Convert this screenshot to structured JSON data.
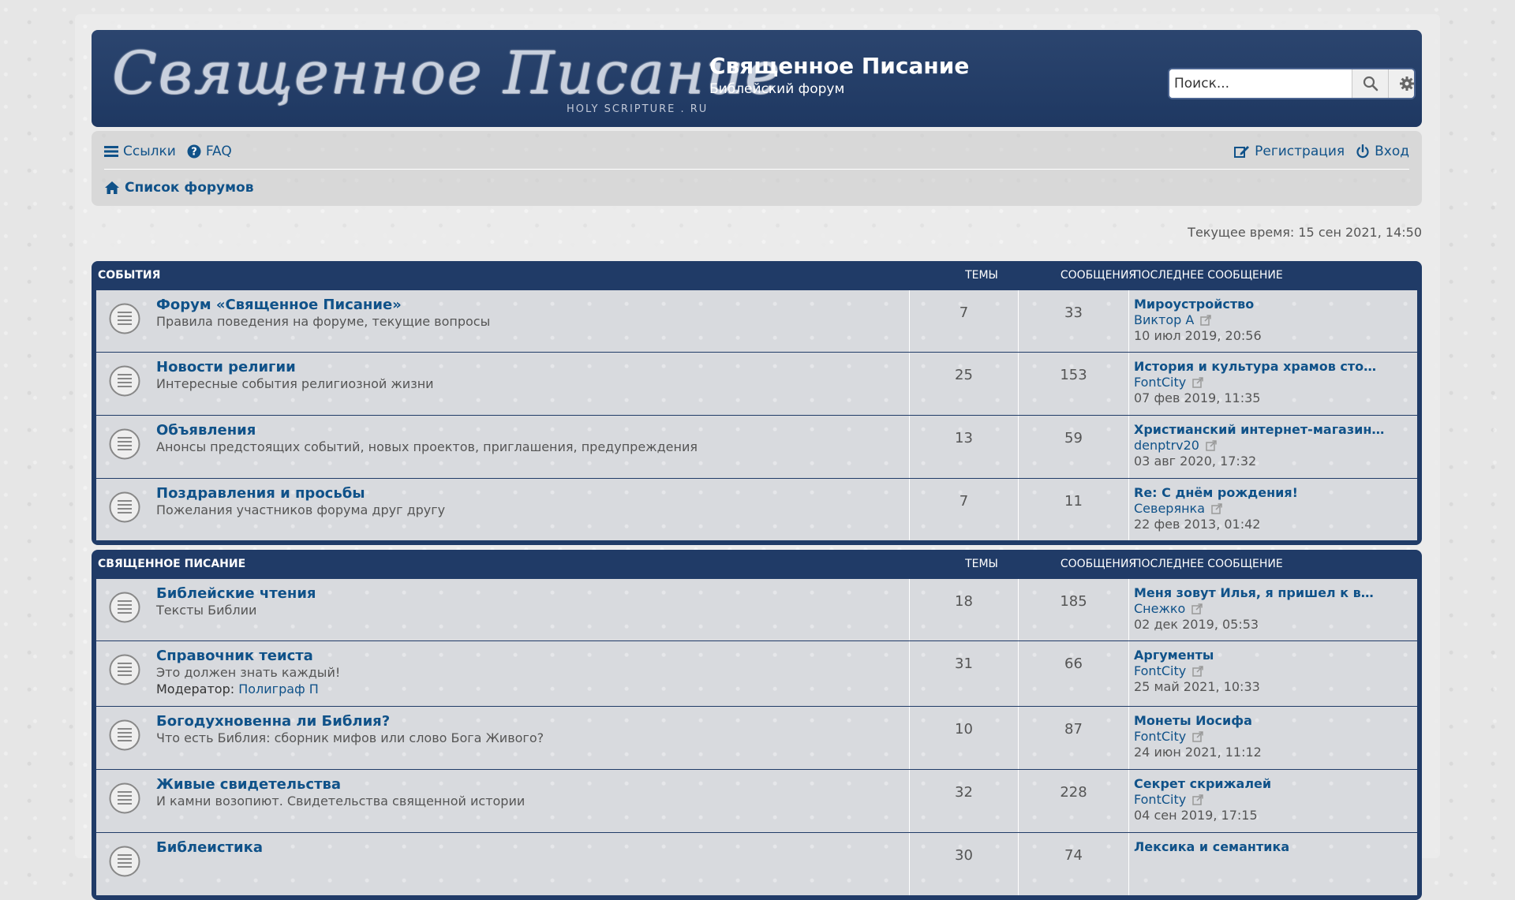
{
  "header": {
    "logo_text": "Священное Писание",
    "logo_sub": "HOLY SCRIPTURE . RU",
    "title": "Священное Писание",
    "description": "Библейский форум",
    "search_placeholder": "Поиск..."
  },
  "nav": {
    "links": "Ссылки",
    "faq": "FAQ",
    "register": "Регистрация",
    "login": "Вход",
    "breadcrumb": "Список форумов"
  },
  "time": "Текущее время: 15 сен 2021, 14:50",
  "categories": [
    {
      "name": "СОБЫТИЯ",
      "col_topics": "ТЕМЫ",
      "col_posts": "СООБЩЕНИЯ",
      "col_last": "ПОСЛЕДНЕЕ СООБЩЕНИЕ",
      "forums": [
        {
          "title": "Форум «Священное Писание»",
          "desc": "Правила поведения на форуме, текущие вопросы",
          "topics": "7",
          "posts": "33",
          "last_title": "Мироустройство",
          "last_author": "Виктор А",
          "last_date": "10 июл 2019, 20:56"
        },
        {
          "title": "Новости религии",
          "desc": "Интересные события религиозной жизни",
          "topics": "25",
          "posts": "153",
          "last_title": "История и культура храмов сто…",
          "last_author": "FontCity",
          "last_date": "07 фев 2019, 11:35"
        },
        {
          "title": "Объявления",
          "desc": "Анонсы предстоящих событий, новых проектов, приглашения, предупреждения",
          "topics": "13",
          "posts": "59",
          "last_title": "Христианский интернет-магазин…",
          "last_author": "denptrv20",
          "last_date": "03 авг 2020, 17:32"
        },
        {
          "title": "Поздравления и просьбы",
          "desc": "Пожелания участников форума друг другу",
          "topics": "7",
          "posts": "11",
          "last_title": "Re: С днём рождения!",
          "last_author": "Северянка",
          "last_date": "22 фев 2013, 01:42"
        }
      ]
    },
    {
      "name": "СВЯЩЕННОЕ ПИСАНИЕ",
      "col_topics": "ТЕМЫ",
      "col_posts": "СООБЩЕНИЯ",
      "col_last": "ПОСЛЕДНЕЕ СООБЩЕНИЕ",
      "forums": [
        {
          "title": "Библейские чтения",
          "desc": "Тексты Библии",
          "topics": "18",
          "posts": "185",
          "last_title": "Меня зовут Илья, я пришел к в…",
          "last_author": "Снежко",
          "last_date": "02 дек 2019, 05:53"
        },
        {
          "title": "Справочник теиста",
          "desc": "Это должен знать каждый!",
          "mod_label": "Модератор:",
          "mod_name": "Полиграф П",
          "topics": "31",
          "posts": "66",
          "last_title": "Аргументы",
          "last_author": "FontCity",
          "last_date": "25 май 2021, 10:33"
        },
        {
          "title": "Богодухновенна ли Библия?",
          "desc": "Что есть Библия: сборник мифов или слово Бога Живого?",
          "topics": "10",
          "posts": "87",
          "last_title": "Монеты Иосифа",
          "last_author": "FontCity",
          "last_date": "24 июн 2021, 11:12"
        },
        {
          "title": "Живые свидетельства",
          "desc": "И камни возопиют. Свидетельства священной истории",
          "topics": "32",
          "posts": "228",
          "last_title": "Секрет скрижалей",
          "last_author": "FontCity",
          "last_date": "04 сен 2019, 17:15"
        },
        {
          "title": "Библеистика",
          "desc": "",
          "topics": "30",
          "posts": "74",
          "last_title": "Лексика и семантика",
          "last_author": "",
          "last_date": ""
        }
      ]
    }
  ]
}
